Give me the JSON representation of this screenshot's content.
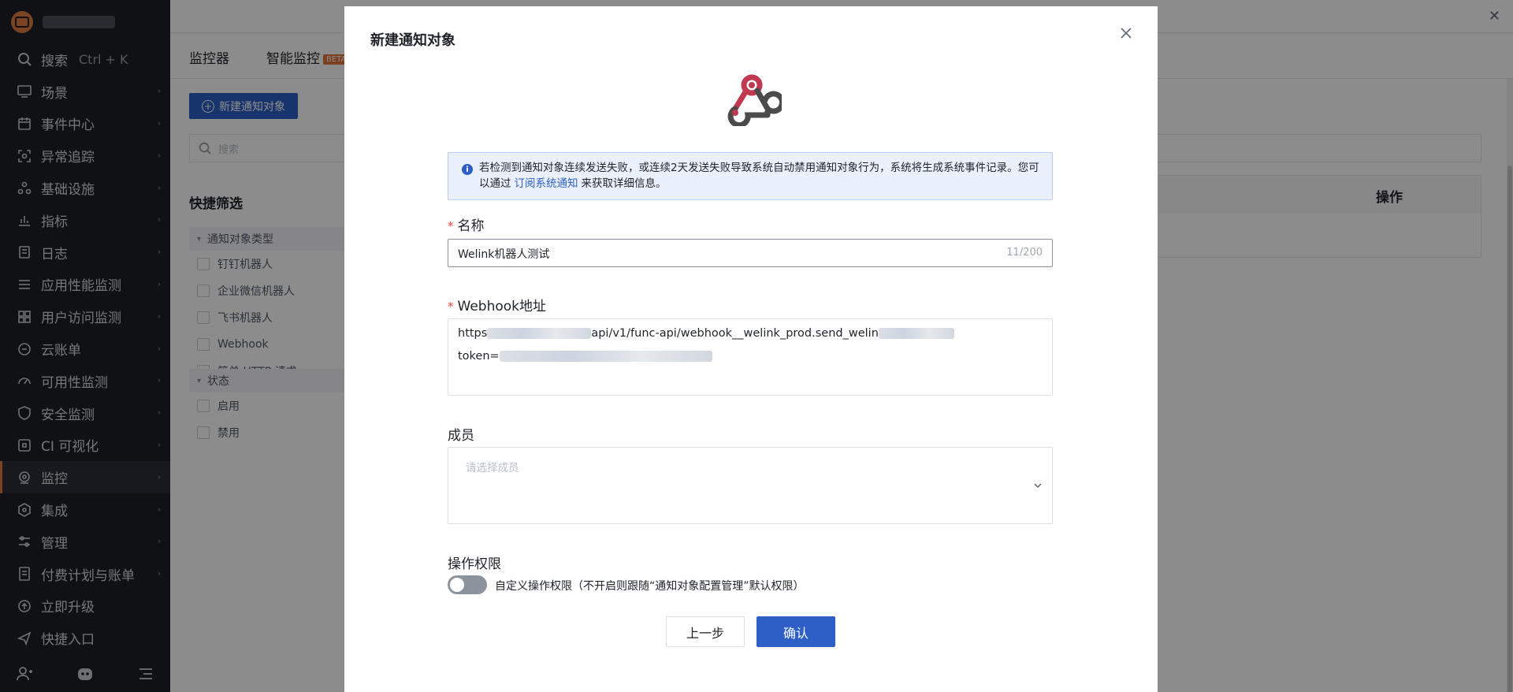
{
  "sidebar": {
    "search": {
      "label": "搜索",
      "shortcut": "Ctrl + K"
    },
    "items": [
      {
        "label": "场景",
        "icon": "monitor-icon"
      },
      {
        "label": "事件中心",
        "icon": "calendar-icon"
      },
      {
        "label": "异常追踪",
        "icon": "scan-icon"
      },
      {
        "label": "基础设施",
        "icon": "nodes-icon"
      },
      {
        "label": "指标",
        "icon": "chart-icon"
      },
      {
        "label": "日志",
        "icon": "log-icon"
      },
      {
        "label": "应用性能监测",
        "icon": "list-icon"
      },
      {
        "label": "用户访问监测",
        "icon": "grid-icon"
      },
      {
        "label": "云账单",
        "icon": "bill-icon"
      },
      {
        "label": "可用性监测",
        "icon": "gauge-icon"
      },
      {
        "label": "安全监测",
        "icon": "shield-icon"
      },
      {
        "label": "CI 可视化",
        "icon": "ci-icon"
      },
      {
        "label": "监控",
        "icon": "monitor-eye-icon",
        "active": true
      },
      {
        "label": "集成",
        "icon": "hexagon-icon"
      },
      {
        "label": "管理",
        "icon": "sliders-icon"
      },
      {
        "label": "付费计划与账单",
        "icon": "receipt-icon"
      },
      {
        "label": "立即升级",
        "icon": "upgrade-icon"
      },
      {
        "label": "快捷入口",
        "icon": "send-icon"
      }
    ]
  },
  "background": {
    "tabs": [
      "监控器",
      "智能监控"
    ],
    "beta_badge": "BETA",
    "new_button": "新建通知对象",
    "search_placeholder": "搜索",
    "quick_filter_title": "快捷筛选",
    "filter_groups": [
      {
        "title": "通知对象类型",
        "options": [
          "钉钉机器人",
          "企业微信机器人",
          "飞书机器人",
          "Webhook",
          "简单 HTTP 请求"
        ]
      },
      {
        "title": "状态",
        "options": [
          "启用",
          "禁用"
        ]
      }
    ],
    "table_header_operation": "操作"
  },
  "modal": {
    "title": "新建通知对象",
    "alert": {
      "text_before": "若检测到通知对象连续发送失败，或连续2天发送失败导致系统自动禁用通知对象行为，系统将生成系统事件记录。您可以通过",
      "link": "订阅系统通知",
      "text_after": "来获取详细信息。"
    },
    "name": {
      "label": "名称",
      "value": "Welink机器人测试",
      "count": "11/200"
    },
    "webhook": {
      "label": "Webhook地址",
      "line1_prefix": "https",
      "line1_visible": "api/v1/func-api/webhook__welink_prod.send_welin",
      "line2_prefix": "token="
    },
    "members": {
      "label": "成员",
      "placeholder": "请选择成员"
    },
    "permission": {
      "label": "操作权限",
      "toggle_label": "自定义操作权限（不开启则跟随“通知对象配置管理”默认权限）",
      "enabled": false
    },
    "buttons": {
      "prev": "上一步",
      "confirm": "确认"
    }
  },
  "colors": {
    "sidebar_bg": "#1c2027",
    "primary": "#2d5fc7",
    "brand_accent": "#e27a3f",
    "required_asterisk": "#e8453c",
    "alert_bg": "#eaf1fc"
  }
}
